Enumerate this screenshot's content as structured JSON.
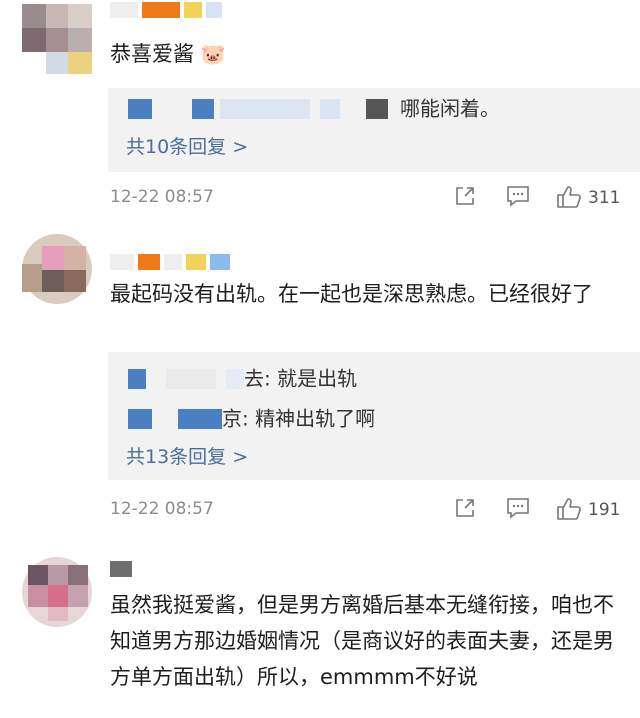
{
  "comments": [
    {
      "text": "恭喜爱酱",
      "emoji": "🐷",
      "reply": {
        "lines": [
          {
            "suffix": "哪能闲着。"
          }
        ],
        "count_label": "共10条回复 >"
      },
      "time": "12-22 08:57",
      "likes": "311"
    },
    {
      "text": "最起码没有出轨。在一起也是深思熟虑。已经很好了",
      "reply": {
        "lines": [
          {
            "suffix": "去: 就是出轨"
          },
          {
            "suffix": "京: 精神出轨了啊"
          }
        ],
        "count_label": "共13条回复 >"
      },
      "time": "12-22 08:57",
      "likes": "191"
    },
    {
      "text": "虽然我挺爱酱，但是男方离婚后基本无缝衔接，咱也不知道男方那边婚姻情况（是商议好的表面夫妻，还是男方单方面出轨）所以，emmmm不好说"
    }
  ],
  "icons": {
    "share": "share-icon",
    "comment": "comment-icon",
    "like": "thumbs-up-icon"
  },
  "colors": {
    "reply_link": "#4a6f9c",
    "reply_bg": "#f2f2f2",
    "meta": "#8c8c8c"
  }
}
